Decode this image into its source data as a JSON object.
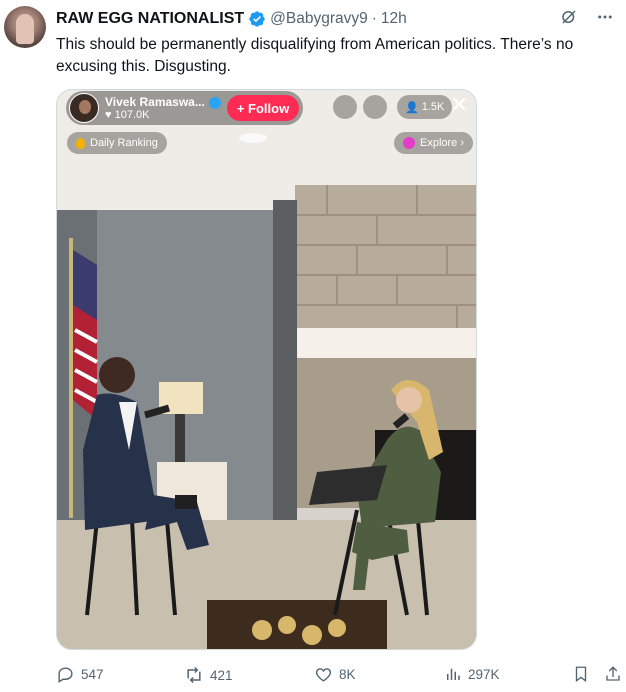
{
  "tweet": {
    "author_name": "RAW EGG NATIONALIST",
    "handle": "@Babygravy9",
    "separator": "·",
    "time": "12h",
    "text": "This should be permanently disqualifying from American politics. There’s no excusing this. Disgusting."
  },
  "media": {
    "creator_name": "Vivek Ramaswa...",
    "creator_likes": "107.0K",
    "follow_label": "+ Follow",
    "viewers": "1.5K",
    "close": "✕",
    "daily_ranking": "Daily Ranking",
    "explore": "Explore ›"
  },
  "actions": {
    "replies": "547",
    "reposts": "421",
    "likes": "8K",
    "views": "297K"
  },
  "colors": {
    "text": "#0f1419",
    "muted": "#536471",
    "verified": "#1d9bf0",
    "follow": "#fe2c55"
  }
}
